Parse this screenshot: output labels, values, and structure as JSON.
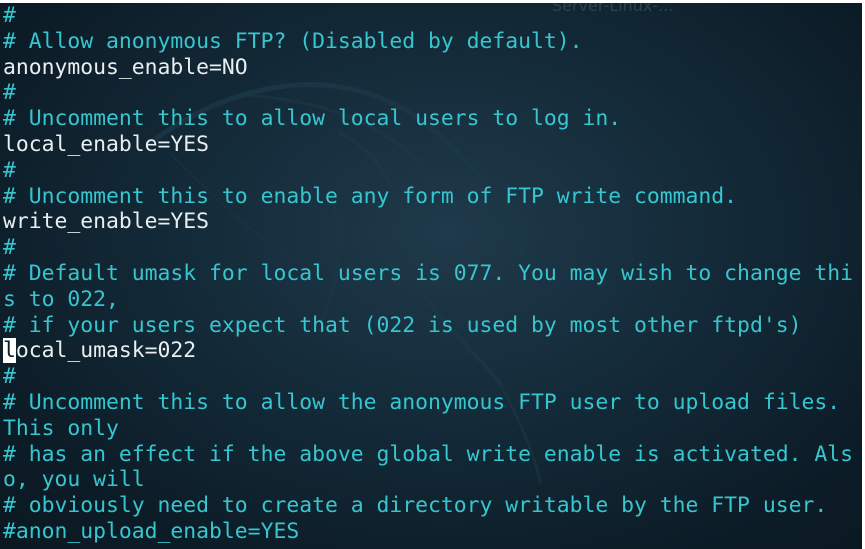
{
  "window": {
    "title_fragment": "Server-Linux-..."
  },
  "editor": {
    "cursor_line": 14,
    "cursor_char": "l",
    "cursor_rest": "ocal_umask=022",
    "lines": [
      {
        "kind": "comment",
        "text": "#"
      },
      {
        "kind": "comment",
        "text": "# Allow anonymous FTP? (Disabled by default)."
      },
      {
        "kind": "setting",
        "text": "anonymous_enable=NO"
      },
      {
        "kind": "comment",
        "text": "#"
      },
      {
        "kind": "comment",
        "text": "# Uncomment this to allow local users to log in."
      },
      {
        "kind": "setting",
        "text": "local_enable=YES"
      },
      {
        "kind": "comment",
        "text": "#"
      },
      {
        "kind": "comment",
        "text": "# Uncomment this to enable any form of FTP write command."
      },
      {
        "kind": "setting",
        "text": "write_enable=YES"
      },
      {
        "kind": "comment",
        "text": "#"
      },
      {
        "kind": "comment",
        "text": "# Default umask for local users is 077. You may wish to change thi"
      },
      {
        "kind": "comment",
        "text": "s to 022,"
      },
      {
        "kind": "comment",
        "text": "# if your users expect that (022 is used by most other ftpd's)"
      },
      {
        "kind": "setting",
        "text": "local_umask=022"
      },
      {
        "kind": "comment",
        "text": "#"
      },
      {
        "kind": "comment",
        "text": "# Uncomment this to allow the anonymous FTP user to upload files."
      },
      {
        "kind": "comment",
        "text": "This only"
      },
      {
        "kind": "comment",
        "text": "# has an effect if the above global write enable is activated. Als"
      },
      {
        "kind": "comment",
        "text": "o, you will"
      },
      {
        "kind": "comment",
        "text": "# obviously need to create a directory writable by the FTP user."
      },
      {
        "kind": "comment",
        "text": "#anon_upload_enable=YES"
      }
    ]
  },
  "colors": {
    "comment": "#36c6cf",
    "setting": "#e9eef0",
    "background": "#132937"
  }
}
